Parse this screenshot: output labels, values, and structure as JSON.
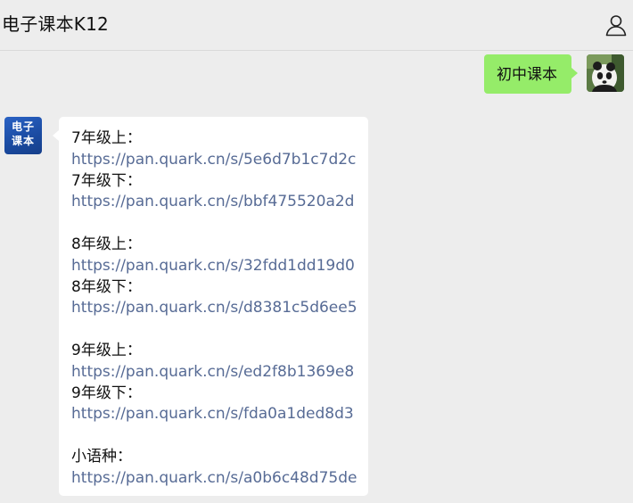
{
  "header": {
    "title": "电子课本K12",
    "profile_icon": "person-outline-icon"
  },
  "chat": {
    "sent_message": {
      "text": "初中课本",
      "bubble_color": "#95ec69",
      "avatar": "panda-avatar"
    },
    "received_message": {
      "avatar_text_line1": "电子",
      "avatar_text_line2": "课本",
      "link_color": "#576b95",
      "sections": [
        {
          "items": [
            {
              "label": "7年级上：",
              "url": "https://pan.quark.cn/s/5e6d7b1c7d2c"
            },
            {
              "label": "7年级下：",
              "url": "https://pan.quark.cn/s/bbf475520a2d"
            }
          ]
        },
        {
          "items": [
            {
              "label": "8年级上：",
              "url": "https://pan.quark.cn/s/32fdd1dd19d0"
            },
            {
              "label": "8年级下：",
              "url": "https://pan.quark.cn/s/d8381c5d6ee5"
            }
          ]
        },
        {
          "items": [
            {
              "label": "9年级上：",
              "url": "https://pan.quark.cn/s/ed2f8b1369e8"
            },
            {
              "label": "9年级下：",
              "url": "https://pan.quark.cn/s/fda0a1ded8d3"
            }
          ]
        },
        {
          "items": [
            {
              "label": "小语种：",
              "url": "https://pan.quark.cn/s/a0b6c48d75de"
            }
          ]
        }
      ]
    }
  }
}
